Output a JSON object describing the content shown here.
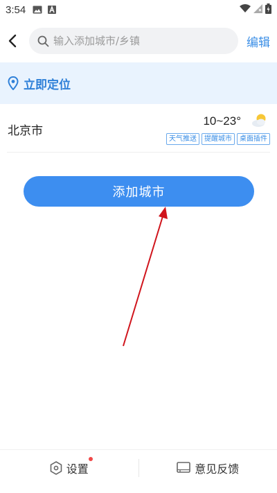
{
  "status_bar": {
    "time": "3:54",
    "icons": [
      "gallery-icon",
      "a-icon",
      "wifi-icon",
      "signal-icon",
      "battery-icon"
    ]
  },
  "header": {
    "search_placeholder": "输入添加城市/乡镇",
    "edit_label": "编辑"
  },
  "locate": {
    "label": "立即定位"
  },
  "cities": [
    {
      "name": "北京市",
      "temp": "10~23°",
      "weather_icon": "partly-cloudy-icon",
      "tags": [
        "天气推送",
        "提醒城市",
        "桌面插件"
      ]
    }
  ],
  "add_city_label": "添加城市",
  "bottom_bar": {
    "settings_label": "设置",
    "feedback_label": "意见反馈"
  },
  "colors": {
    "accent": "#3d8ef0",
    "locate_bg": "#e9f3fe",
    "arrow": "#d0141c",
    "badge": "#f04848"
  }
}
